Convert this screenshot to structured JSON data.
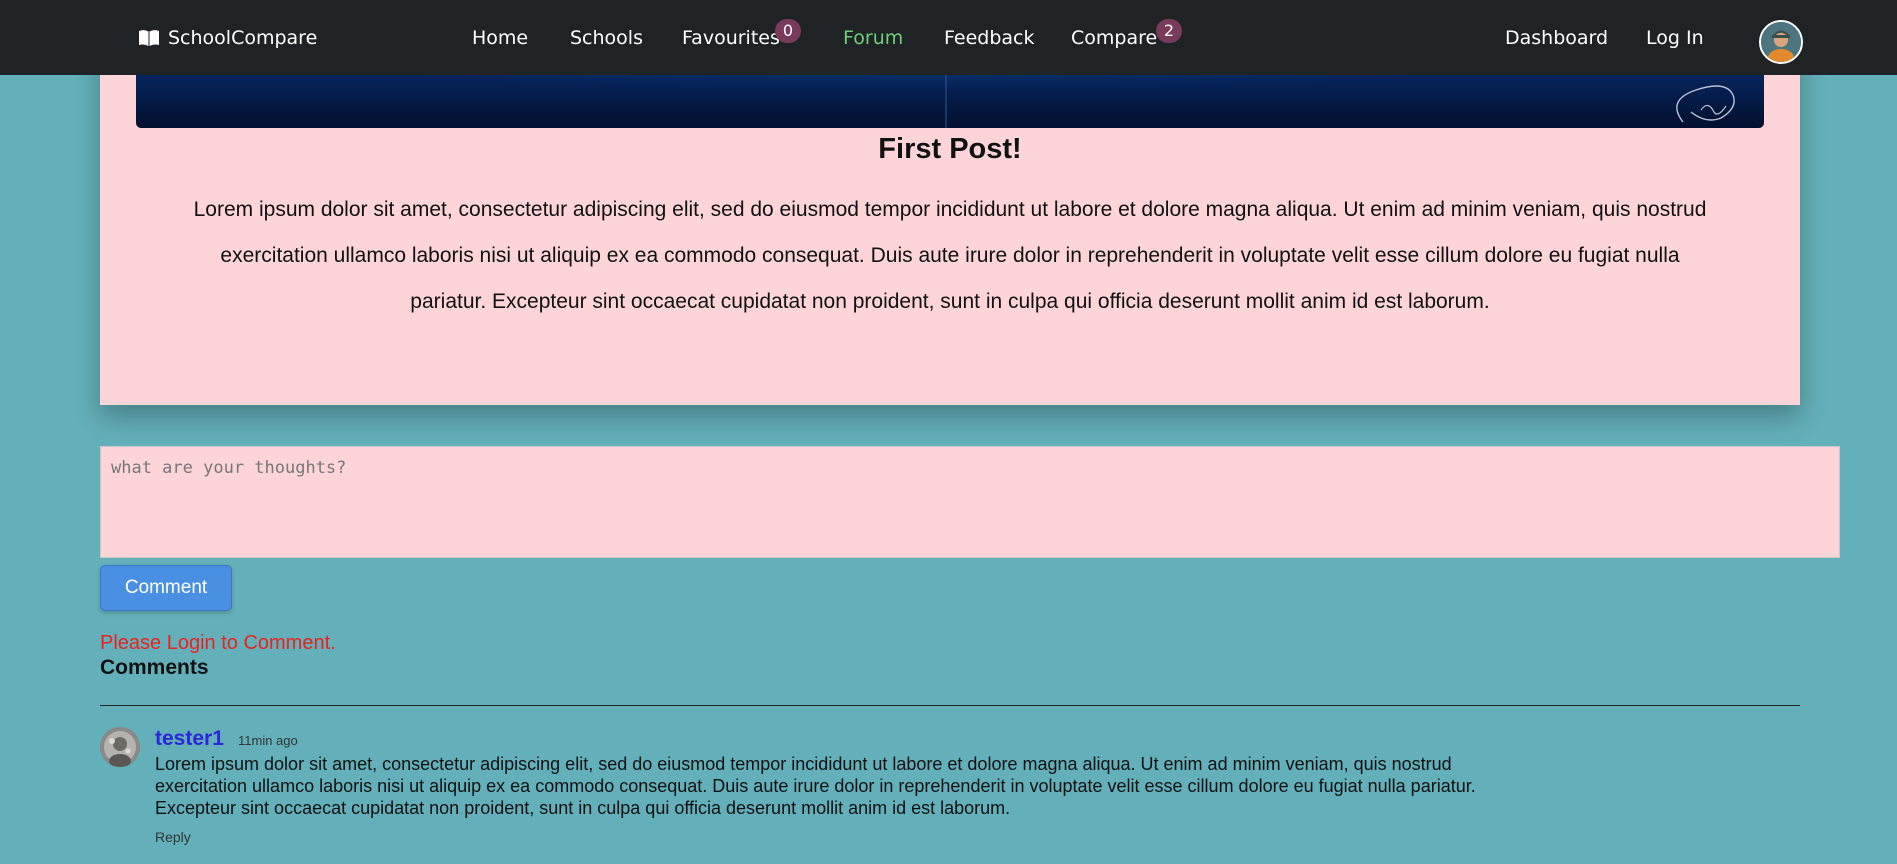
{
  "navbar": {
    "brand": "SchoolCompare",
    "links": {
      "home": "Home",
      "schools": "Schools",
      "favourites": "Favourites",
      "forum": "Forum",
      "feedback": "Feedback",
      "compare": "Compare",
      "dashboard": "Dashboard",
      "login": "Log In"
    },
    "badges": {
      "favourites": "0",
      "compare": "2"
    },
    "active": "Forum",
    "active_color": "#6fcf76"
  },
  "post": {
    "title": "First Post!",
    "body": "Lorem ipsum dolor sit amet, consectetur adipiscing elit, sed do eiusmod tempor incididunt ut labore et dolore magna aliqua. Ut enim ad minim veniam, quis nostrud exercitation ullamco laboris nisi ut aliquip ex ea commodo consequat. Duis aute irure dolor in reprehenderit in voluptate velit esse cillum dolore eu fugiat nulla pariatur. Excepteur sint occaecat cupidatat non proident, sunt in culpa qui officia deserunt mollit anim id est laborum."
  },
  "comment_form": {
    "placeholder": "what are your thoughts?",
    "value": "",
    "button_label": "Comment",
    "login_warning": "Please Login to Comment."
  },
  "comments_section": {
    "heading": "Comments",
    "items": [
      {
        "author": "tester1",
        "time": "11min ago",
        "text": "Lorem ipsum dolor sit amet, consectetur adipiscing elit, sed do eiusmod tempor incididunt ut labore et dolore magna aliqua. Ut enim ad minim veniam, quis nostrud exercitation ullamco laboris nisi ut aliquip ex ea commodo consequat. Duis aute irure dolor in reprehenderit in voluptate velit esse cillum dolore eu fugiat nulla pariatur. Excepteur sint occaecat cupidatat non proident, sunt in culpa qui officia deserunt mollit anim id est laborum.",
        "reply_label": "Reply"
      }
    ]
  },
  "colors": {
    "page_background": "#63b0ba",
    "card_background": "#fdd5d8",
    "navbar_background": "#1f2326",
    "button": "#4a90e2",
    "warning": "#e8231e",
    "author": "#2b27d9",
    "badge": "#7a3b5b"
  },
  "icons": {
    "brand": "open-book-icon",
    "profile": "user-avatar",
    "banner_decoration": "signature-drawing"
  }
}
